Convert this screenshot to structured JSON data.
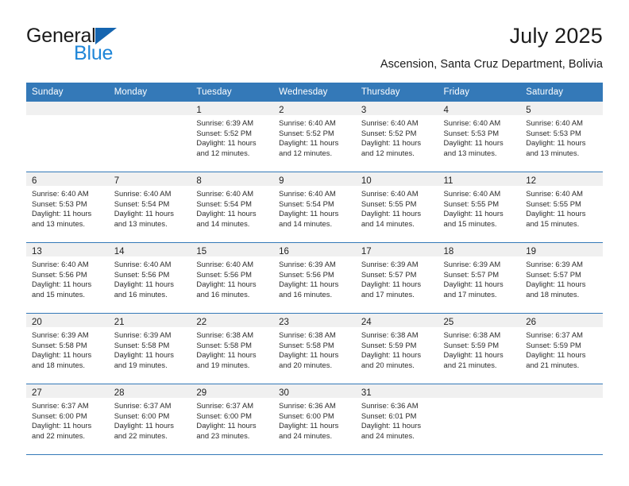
{
  "brand": {
    "name_top": "General",
    "name_bottom": "Blue",
    "mark": "triangle-logo",
    "colors": {
      "dark": "#1b1b1b",
      "blue": "#1f86d8",
      "mark": "#1565b0"
    }
  },
  "header": {
    "title": "July 2025",
    "subtitle": "Ascension, Santa Cruz Department, Bolivia"
  },
  "theme": {
    "header_blue": "#3479b8",
    "row_divider": "#3479b8",
    "daynum_band": "#f0f0f0",
    "text": "#2b2b2b"
  },
  "calendar": {
    "weekday_headers": [
      "Sunday",
      "Monday",
      "Tuesday",
      "Wednesday",
      "Thursday",
      "Friday",
      "Saturday"
    ],
    "weeks": [
      [
        {
          "empty": true
        },
        {
          "empty": true
        },
        {
          "day": "1",
          "sunrise": "Sunrise: 6:39 AM",
          "sunset": "Sunset: 5:52 PM",
          "daylight_1": "Daylight: 11 hours",
          "daylight_2": "and 12 minutes."
        },
        {
          "day": "2",
          "sunrise": "Sunrise: 6:40 AM",
          "sunset": "Sunset: 5:52 PM",
          "daylight_1": "Daylight: 11 hours",
          "daylight_2": "and 12 minutes."
        },
        {
          "day": "3",
          "sunrise": "Sunrise: 6:40 AM",
          "sunset": "Sunset: 5:52 PM",
          "daylight_1": "Daylight: 11 hours",
          "daylight_2": "and 12 minutes."
        },
        {
          "day": "4",
          "sunrise": "Sunrise: 6:40 AM",
          "sunset": "Sunset: 5:53 PM",
          "daylight_1": "Daylight: 11 hours",
          "daylight_2": "and 13 minutes."
        },
        {
          "day": "5",
          "sunrise": "Sunrise: 6:40 AM",
          "sunset": "Sunset: 5:53 PM",
          "daylight_1": "Daylight: 11 hours",
          "daylight_2": "and 13 minutes."
        }
      ],
      [
        {
          "day": "6",
          "sunrise": "Sunrise: 6:40 AM",
          "sunset": "Sunset: 5:53 PM",
          "daylight_1": "Daylight: 11 hours",
          "daylight_2": "and 13 minutes."
        },
        {
          "day": "7",
          "sunrise": "Sunrise: 6:40 AM",
          "sunset": "Sunset: 5:54 PM",
          "daylight_1": "Daylight: 11 hours",
          "daylight_2": "and 13 minutes."
        },
        {
          "day": "8",
          "sunrise": "Sunrise: 6:40 AM",
          "sunset": "Sunset: 5:54 PM",
          "daylight_1": "Daylight: 11 hours",
          "daylight_2": "and 14 minutes."
        },
        {
          "day": "9",
          "sunrise": "Sunrise: 6:40 AM",
          "sunset": "Sunset: 5:54 PM",
          "daylight_1": "Daylight: 11 hours",
          "daylight_2": "and 14 minutes."
        },
        {
          "day": "10",
          "sunrise": "Sunrise: 6:40 AM",
          "sunset": "Sunset: 5:55 PM",
          "daylight_1": "Daylight: 11 hours",
          "daylight_2": "and 14 minutes."
        },
        {
          "day": "11",
          "sunrise": "Sunrise: 6:40 AM",
          "sunset": "Sunset: 5:55 PM",
          "daylight_1": "Daylight: 11 hours",
          "daylight_2": "and 15 minutes."
        },
        {
          "day": "12",
          "sunrise": "Sunrise: 6:40 AM",
          "sunset": "Sunset: 5:55 PM",
          "daylight_1": "Daylight: 11 hours",
          "daylight_2": "and 15 minutes."
        }
      ],
      [
        {
          "day": "13",
          "sunrise": "Sunrise: 6:40 AM",
          "sunset": "Sunset: 5:56 PM",
          "daylight_1": "Daylight: 11 hours",
          "daylight_2": "and 15 minutes."
        },
        {
          "day": "14",
          "sunrise": "Sunrise: 6:40 AM",
          "sunset": "Sunset: 5:56 PM",
          "daylight_1": "Daylight: 11 hours",
          "daylight_2": "and 16 minutes."
        },
        {
          "day": "15",
          "sunrise": "Sunrise: 6:40 AM",
          "sunset": "Sunset: 5:56 PM",
          "daylight_1": "Daylight: 11 hours",
          "daylight_2": "and 16 minutes."
        },
        {
          "day": "16",
          "sunrise": "Sunrise: 6:39 AM",
          "sunset": "Sunset: 5:56 PM",
          "daylight_1": "Daylight: 11 hours",
          "daylight_2": "and 16 minutes."
        },
        {
          "day": "17",
          "sunrise": "Sunrise: 6:39 AM",
          "sunset": "Sunset: 5:57 PM",
          "daylight_1": "Daylight: 11 hours",
          "daylight_2": "and 17 minutes."
        },
        {
          "day": "18",
          "sunrise": "Sunrise: 6:39 AM",
          "sunset": "Sunset: 5:57 PM",
          "daylight_1": "Daylight: 11 hours",
          "daylight_2": "and 17 minutes."
        },
        {
          "day": "19",
          "sunrise": "Sunrise: 6:39 AM",
          "sunset": "Sunset: 5:57 PM",
          "daylight_1": "Daylight: 11 hours",
          "daylight_2": "and 18 minutes."
        }
      ],
      [
        {
          "day": "20",
          "sunrise": "Sunrise: 6:39 AM",
          "sunset": "Sunset: 5:58 PM",
          "daylight_1": "Daylight: 11 hours",
          "daylight_2": "and 18 minutes."
        },
        {
          "day": "21",
          "sunrise": "Sunrise: 6:39 AM",
          "sunset": "Sunset: 5:58 PM",
          "daylight_1": "Daylight: 11 hours",
          "daylight_2": "and 19 minutes."
        },
        {
          "day": "22",
          "sunrise": "Sunrise: 6:38 AM",
          "sunset": "Sunset: 5:58 PM",
          "daylight_1": "Daylight: 11 hours",
          "daylight_2": "and 19 minutes."
        },
        {
          "day": "23",
          "sunrise": "Sunrise: 6:38 AM",
          "sunset": "Sunset: 5:58 PM",
          "daylight_1": "Daylight: 11 hours",
          "daylight_2": "and 20 minutes."
        },
        {
          "day": "24",
          "sunrise": "Sunrise: 6:38 AM",
          "sunset": "Sunset: 5:59 PM",
          "daylight_1": "Daylight: 11 hours",
          "daylight_2": "and 20 minutes."
        },
        {
          "day": "25",
          "sunrise": "Sunrise: 6:38 AM",
          "sunset": "Sunset: 5:59 PM",
          "daylight_1": "Daylight: 11 hours",
          "daylight_2": "and 21 minutes."
        },
        {
          "day": "26",
          "sunrise": "Sunrise: 6:37 AM",
          "sunset": "Sunset: 5:59 PM",
          "daylight_1": "Daylight: 11 hours",
          "daylight_2": "and 21 minutes."
        }
      ],
      [
        {
          "day": "27",
          "sunrise": "Sunrise: 6:37 AM",
          "sunset": "Sunset: 6:00 PM",
          "daylight_1": "Daylight: 11 hours",
          "daylight_2": "and 22 minutes."
        },
        {
          "day": "28",
          "sunrise": "Sunrise: 6:37 AM",
          "sunset": "Sunset: 6:00 PM",
          "daylight_1": "Daylight: 11 hours",
          "daylight_2": "and 22 minutes."
        },
        {
          "day": "29",
          "sunrise": "Sunrise: 6:37 AM",
          "sunset": "Sunset: 6:00 PM",
          "daylight_1": "Daylight: 11 hours",
          "daylight_2": "and 23 minutes."
        },
        {
          "day": "30",
          "sunrise": "Sunrise: 6:36 AM",
          "sunset": "Sunset: 6:00 PM",
          "daylight_1": "Daylight: 11 hours",
          "daylight_2": "and 24 minutes."
        },
        {
          "day": "31",
          "sunrise": "Sunrise: 6:36 AM",
          "sunset": "Sunset: 6:01 PM",
          "daylight_1": "Daylight: 11 hours",
          "daylight_2": "and 24 minutes."
        },
        {
          "empty": true
        },
        {
          "empty": true
        }
      ]
    ]
  }
}
